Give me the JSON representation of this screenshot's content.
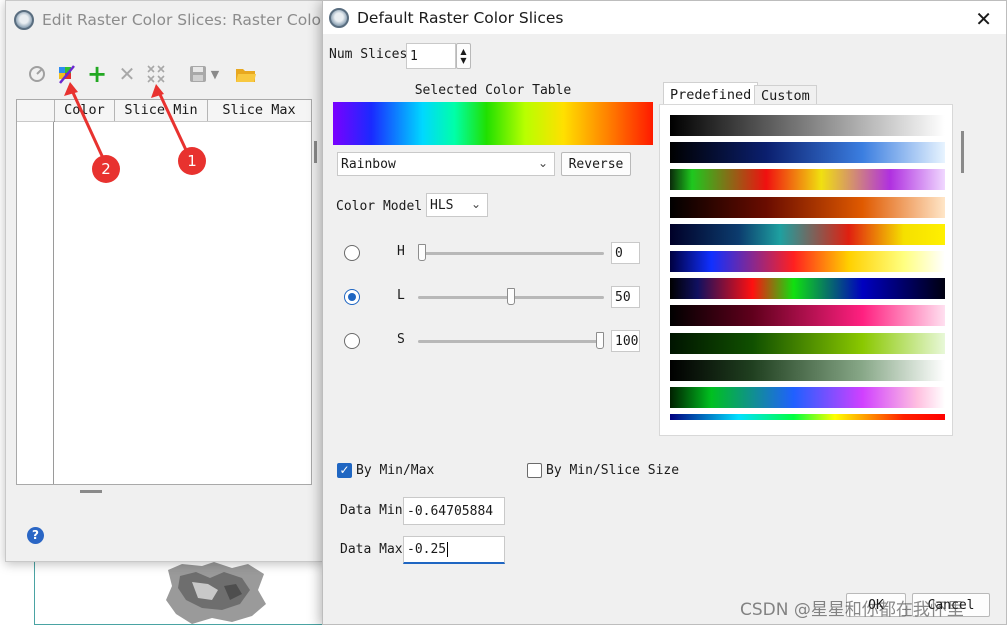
{
  "background": {
    "map_region": "raster-map-thumbnail"
  },
  "edit_window": {
    "title": "Edit Raster Color Slices: Raster Color Slices",
    "toolbar": {
      "icons": [
        "clear-icon",
        "auto-slice-icon",
        "add-icon",
        "delete-icon",
        "delete-all-icon",
        "save-icon",
        "dropdown-icon",
        "open-folder-icon"
      ]
    },
    "table": {
      "columns": [
        "Color",
        "Slice Min",
        "Slice Max"
      ]
    },
    "annotations": [
      {
        "label": "1"
      },
      {
        "label": "2"
      }
    ]
  },
  "dialog": {
    "title": "Default Raster Color Slices",
    "num_slices_label": "Num Slices",
    "num_slices_value": "1",
    "selected_color_table_label": "Selected Color Table",
    "color_table_value": "Rainbow",
    "reverse_label": "Reverse",
    "color_model_label": "Color Model",
    "color_model_value": "HLS",
    "sliders": [
      {
        "label": "H",
        "value": "0",
        "selected": false,
        "fraction": 0.0
      },
      {
        "label": "L",
        "value": "50",
        "selected": true,
        "fraction": 0.5
      },
      {
        "label": "S",
        "value": "100",
        "selected": false,
        "fraction": 1.0
      }
    ],
    "tabs": [
      {
        "label": "Predefined",
        "active": true
      },
      {
        "label": "Custom",
        "active": false
      }
    ],
    "ramps": [
      "linear-gradient(90deg,#000,#fff)",
      "linear-gradient(90deg,#000,#0b1f6e 35%,#3b7ee0 70%,#e8f4ff)",
      "linear-gradient(90deg,#0a2a0a,#1ec81e 8%,#f01010 35%,#f0e010 55%,#b030e0 80%,#f0d8ff)",
      "linear-gradient(90deg,#000,#6a0c00 35%,#e05a00 70%,#ffe6c8)",
      "linear-gradient(90deg,#000028,#0c3c6e 25%,#1ea0a0 40%,#e02010 65%,#f5e000 85%,#fff000)",
      "linear-gradient(90deg,#000040,#1030ff 15%,#ff2020 45%,#ffd000 65%,#ffff80 85%,#ffffff)",
      "linear-gradient(90deg,#000,#101060 10%,#ff1010 30%,#10e010 45%,#0000c0 70%,#000010)",
      "linear-gradient(90deg,#000,#60001c 30%,#ff2080 70%,#ffe0f0)",
      "linear-gradient(90deg,#001400,#105000 30%,#8ac800 70%,#e8f8d8)",
      "linear-gradient(90deg,#000,#204020 30%,#88a888 70%,#ffffff)",
      "linear-gradient(90deg,#002000,#00c020 15%,#2060ff 45%,#d040ff 70%,#ffc0e0 90%,#ffffff)",
      "linear-gradient(90deg,#000080,#00e0ff 25%,#00ff40 45%,#ffff00 60%,#ff2000 85%,#ff0000)"
    ],
    "selected_gradient": "linear-gradient(90deg,#7a00ff 0%,#1a2aff 12%,#00d8ff 28%,#00ffa8 38%,#20e000 48%,#b8ff00 60%,#ffe000 72%,#ff8000 86%,#ff1a00 100%)",
    "by_min_max_label": "By Min/Max",
    "by_min_max_checked": true,
    "by_min_slice_size_label": "By Min/Slice Size",
    "by_min_slice_size_checked": false,
    "data_min_label": "Data Min",
    "data_min_value": "-0.64705884",
    "data_max_label": "Data Max",
    "data_max_value": "-0.25",
    "ok_label": "OK",
    "cancel_label": "Cancel"
  },
  "watermark": "CSDN @星星和你都在我怀里",
  "colors": {
    "accent": "#1f66c2",
    "annotation": "#e8322f",
    "help": "#2a66c5"
  }
}
